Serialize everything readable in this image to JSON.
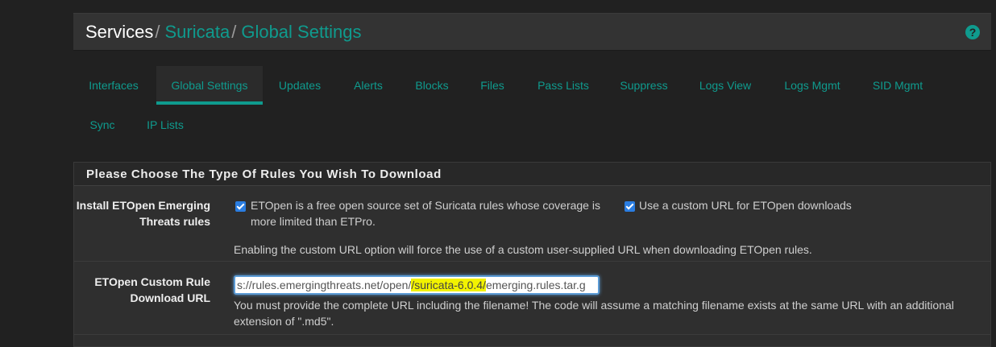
{
  "header": {
    "breadcrumb": [
      "Services",
      "Suricata",
      "Global Settings"
    ],
    "separator": "/",
    "help_icon": "question-circle-icon"
  },
  "tabs": {
    "row1": [
      "Interfaces",
      "Global Settings",
      "Updates",
      "Alerts",
      "Blocks",
      "Files",
      "Pass Lists",
      "Suppress",
      "Logs View",
      "Logs Mgmt",
      "SID Mgmt"
    ],
    "row2": [
      "Sync",
      "IP Lists"
    ],
    "active": "Global Settings"
  },
  "panel": {
    "title": "Please Choose The Type Of Rules You Wish To Download",
    "etopen": {
      "label_line1": "Install ETOpen Emerging",
      "label_line2": "Threats rules",
      "checkbox_checked": true,
      "desc_line1": "ETOpen is a free open source set of Suricata rules whose coverage is",
      "desc_line2": "more limited than ETPro.",
      "custom_url_checked": true,
      "custom_url_label": "Use a custom URL for ETOpen downloads",
      "help": "Enabling the custom URL option will force the use of a custom user-supplied URL when downloading ETOpen rules."
    },
    "custom_url": {
      "label_line1": "ETOpen Custom Rule",
      "label_line2": "Download URL",
      "value_part1": "s://rules.emergingthreats.net/open/",
      "value_highlight": "/suricata-6.0.4/",
      "value_part2": "emerging.rules.tar.g",
      "help_line1": "You must provide the complete URL including the filename! The code will assume a matching filename exists at the same URL with an additional",
      "help_line2": "extension of \".md5\"."
    }
  },
  "colors": {
    "accent": "#0f9b8e",
    "checkbox": "#2a7de1",
    "highlight": "#f2f200"
  }
}
